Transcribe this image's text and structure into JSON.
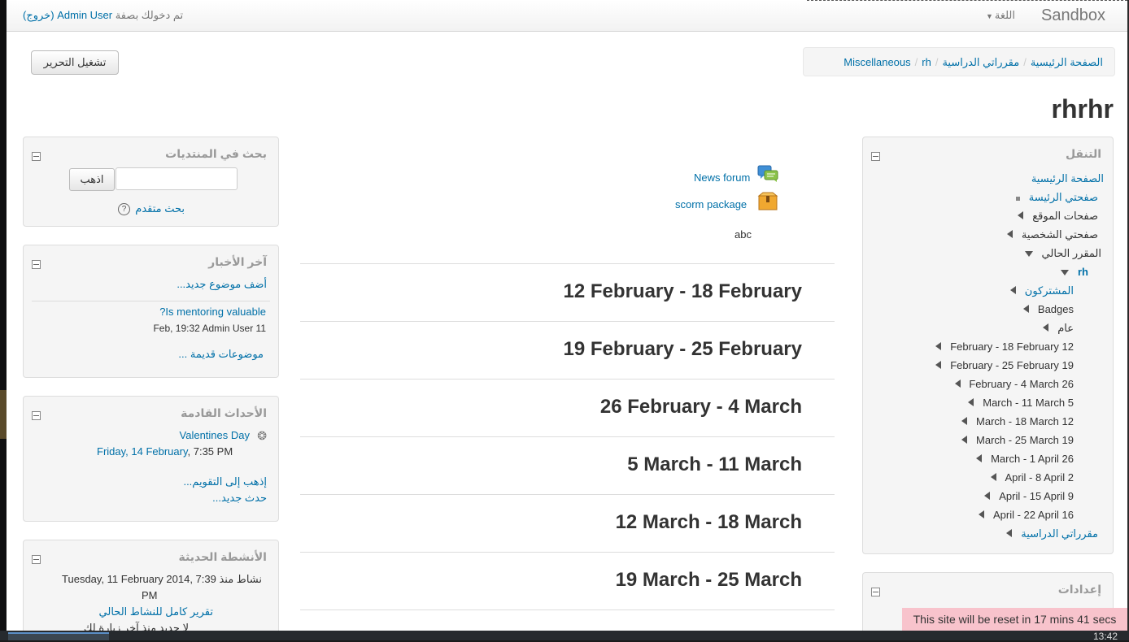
{
  "navbar": {
    "brand": "Sandbox",
    "language": "اللغة",
    "login_prefix": "تم دخولك بصفة",
    "user": "Admin User",
    "logout": "(خروج)"
  },
  "breadcrumb": [
    "الصفحة الرئيسية",
    "مقرراتي الدراسية",
    "Miscellaneous",
    "rh"
  ],
  "edit_button": "تشغيل التحرير",
  "page_title": "rhrhr",
  "navigation": {
    "title": "التنقل",
    "items": [
      {
        "label": "الصفحة الرئيسية"
      },
      {
        "label": "صفحتي الرئيسة"
      },
      {
        "label": "صفحات الموقع"
      },
      {
        "label": "صفحتي الشخصية"
      },
      {
        "label": "المقرر الحالي"
      },
      {
        "label": "rh"
      },
      {
        "label": "المشتركون"
      },
      {
        "label": "Badges"
      },
      {
        "label": "عام"
      },
      {
        "label": "12 February - 18 February"
      },
      {
        "label": "19 February - 25 February"
      },
      {
        "label": "26 February - 4 March"
      },
      {
        "label": "5 March - 11 March"
      },
      {
        "label": "12 March - 18 March"
      },
      {
        "label": "19 March - 25 March"
      },
      {
        "label": "26 March - 1 April"
      },
      {
        "label": "2 April - 8 April"
      },
      {
        "label": "9 April - 15 April"
      },
      {
        "label": "16 April - 22 April"
      },
      {
        "label": "مقرراتي الدراسية"
      }
    ]
  },
  "settings": {
    "title": "إعدادات"
  },
  "forum_search": {
    "title": "بحث في المنتديات",
    "go": "اذهب",
    "advanced": "بحث متقدم",
    "help": "?"
  },
  "news": {
    "title": "آخر الأخبار",
    "add": "أضف موضوع جديد...",
    "post_title": "Is mentoring valuable?",
    "post_meta": "11 Feb, 19:32 Admin User",
    "older": "موضوعات قديمة ..."
  },
  "events": {
    "title": "الأحداث القادمة",
    "event_name": "Valentines Day",
    "event_date": "Friday, 14 February",
    "event_time": ", 7:35 PM",
    "goto_calendar": "إذهب إلى التقويم...",
    "new_event": "حدث جديد..."
  },
  "recent": {
    "title": "الأنشطة الحديثة",
    "since": "نشاط منذ Tuesday, 11 February 2014, 7:39",
    "since_pm": "PM",
    "full_report": "تقرير كامل للنشاط الحالي",
    "nothing_new": "لا جديد منذ آخر زيارة لك"
  },
  "activities": {
    "forum": "News forum",
    "scorm": "scorm package",
    "label": "abc"
  },
  "sections": [
    "12 February - 18 February",
    "19 February - 25 February",
    "26 February - 4 March",
    "5 March - 11 March",
    "12 March - 18 March",
    "19 March - 25 March"
  ],
  "reset_notice": "This site will be reset in 17 mins 41 secs",
  "taskbar": {
    "clock": "13:42"
  },
  "colors": {
    "link": "#0070a8",
    "notice_bg": "#f8c3cc",
    "block_bg": "#f5f5f5"
  }
}
